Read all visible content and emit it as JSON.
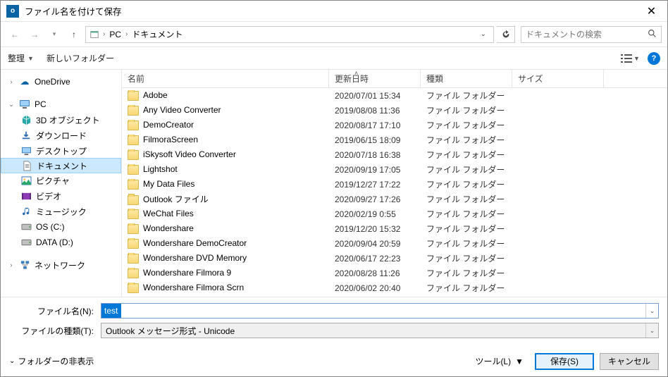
{
  "window": {
    "title": "ファイル名を付けて保存"
  },
  "nav": {
    "breadcrumb": {
      "root": "PC",
      "current": "ドキュメント"
    },
    "search_placeholder": "ドキュメントの検索"
  },
  "toolbar": {
    "organize": "整理",
    "newfolder": "新しいフォルダー"
  },
  "tree": {
    "onedrive": "OneDrive",
    "pc": "PC",
    "items": [
      {
        "icon": "3d",
        "label": "3D オブジェクト"
      },
      {
        "icon": "dl",
        "label": "ダウンロード"
      },
      {
        "icon": "desk",
        "label": "デスクトップ"
      },
      {
        "icon": "doc",
        "label": "ドキュメント",
        "selected": true
      },
      {
        "icon": "pic",
        "label": "ピクチャ"
      },
      {
        "icon": "vid",
        "label": "ビデオ"
      },
      {
        "icon": "mus",
        "label": "ミュージック"
      },
      {
        "icon": "disk",
        "label": "OS (C:)"
      },
      {
        "icon": "disk",
        "label": "DATA (D:)"
      }
    ],
    "network": "ネットワーク"
  },
  "columns": {
    "name": "名前",
    "date": "更新日時",
    "type": "種類",
    "size": "サイズ"
  },
  "files": [
    {
      "name": "Adobe",
      "date": "2020/07/01 15:34",
      "type": "ファイル フォルダー"
    },
    {
      "name": "Any Video Converter",
      "date": "2019/08/08 11:36",
      "type": "ファイル フォルダー"
    },
    {
      "name": "DemoCreator",
      "date": "2020/08/17 17:10",
      "type": "ファイル フォルダー"
    },
    {
      "name": "FilmoraScreen",
      "date": "2019/06/15 18:09",
      "type": "ファイル フォルダー"
    },
    {
      "name": "iSkysoft Video Converter",
      "date": "2020/07/18 16:38",
      "type": "ファイル フォルダー"
    },
    {
      "name": "Lightshot",
      "date": "2020/09/19 17:05",
      "type": "ファイル フォルダー"
    },
    {
      "name": "My Data Files",
      "date": "2019/12/27 17:22",
      "type": "ファイル フォルダー"
    },
    {
      "name": "Outlook ファイル",
      "date": "2020/09/27 17:26",
      "type": "ファイル フォルダー"
    },
    {
      "name": "WeChat Files",
      "date": "2020/02/19 0:55",
      "type": "ファイル フォルダー"
    },
    {
      "name": "Wondershare",
      "date": "2019/12/20 15:32",
      "type": "ファイル フォルダー"
    },
    {
      "name": "Wondershare DemoCreator",
      "date": "2020/09/04 20:59",
      "type": "ファイル フォルダー"
    },
    {
      "name": "Wondershare DVD Memory",
      "date": "2020/06/17 22:23",
      "type": "ファイル フォルダー"
    },
    {
      "name": "Wondershare Filmora 9",
      "date": "2020/08/28 11:26",
      "type": "ファイル フォルダー"
    },
    {
      "name": "Wondershare Filmora Scrn",
      "date": "2020/06/02 20:40",
      "type": "ファイル フォルダー"
    }
  ],
  "fields": {
    "filename_label": "ファイル名(N):",
    "filename_value": "test",
    "filetype_label": "ファイルの種類(T):",
    "filetype_value": "Outlook メッセージ形式 - Unicode"
  },
  "actions": {
    "hide_folders": "フォルダーの非表示",
    "tools": "ツール(L)",
    "save": "保存(S)",
    "cancel": "キャンセル"
  }
}
